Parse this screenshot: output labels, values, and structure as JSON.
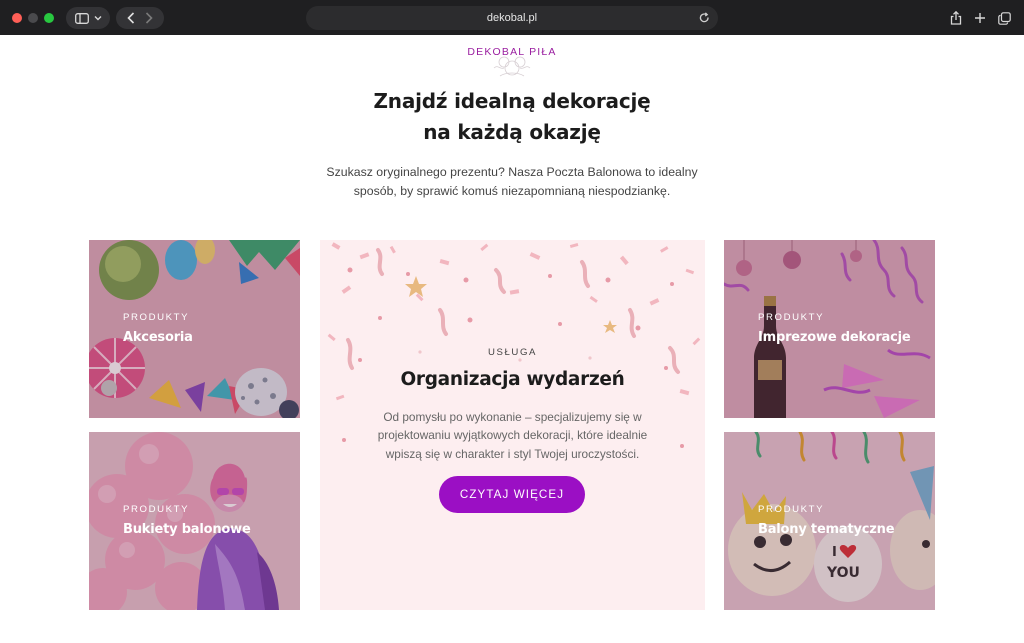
{
  "browser": {
    "url": "dekobal.pl",
    "icons": [
      "sidebar-icon",
      "chevron-down-icon",
      "back-icon",
      "forward-icon",
      "reload-icon",
      "share-icon",
      "new-tab-icon",
      "tabs-overview-icon"
    ]
  },
  "header": {
    "logo_text": "DEKOBAL PIŁA",
    "heading_line1": "Znajdź idealną dekorację",
    "heading_line2": "na każdą okazję",
    "intro_line1": "Szukasz oryginalnego prezentu? Nasza Poczta Balonowa to idealny",
    "intro_line2": "sposób, by sprawić komuś niezapomnianą niespodziankę."
  },
  "tiles": [
    {
      "category": "PRODUKTY",
      "title": "Akcesoria"
    },
    {
      "category": "PRODUKTY",
      "title": "Bukiety balonowe"
    },
    {
      "category": "PRODUKTY",
      "title": "Imprezowe dekoracje"
    },
    {
      "category": "PRODUKTY",
      "title": "Balony tematyczne"
    }
  ],
  "feature": {
    "category": "USŁUGA",
    "title": "Organizacja wydarzeń",
    "desc_line1": "Od pomysłu po wykonanie – specjalizujemy się w",
    "desc_line2": "projektowaniu wyjątkowych dekoracji, które idealnie",
    "desc_line3": "wpiszą się w charakter i styl Twojej uroczystości.",
    "button_label": "CZYTAJ WIĘCEJ"
  },
  "balloon_text": {
    "line1": "I",
    "line2": "YOU"
  },
  "colors": {
    "brand_purple": "#9b0fc4",
    "logo_purple": "#9a1fa0",
    "feature_bg": "#fdeef0",
    "chrome_bg": "#1f1f21"
  }
}
